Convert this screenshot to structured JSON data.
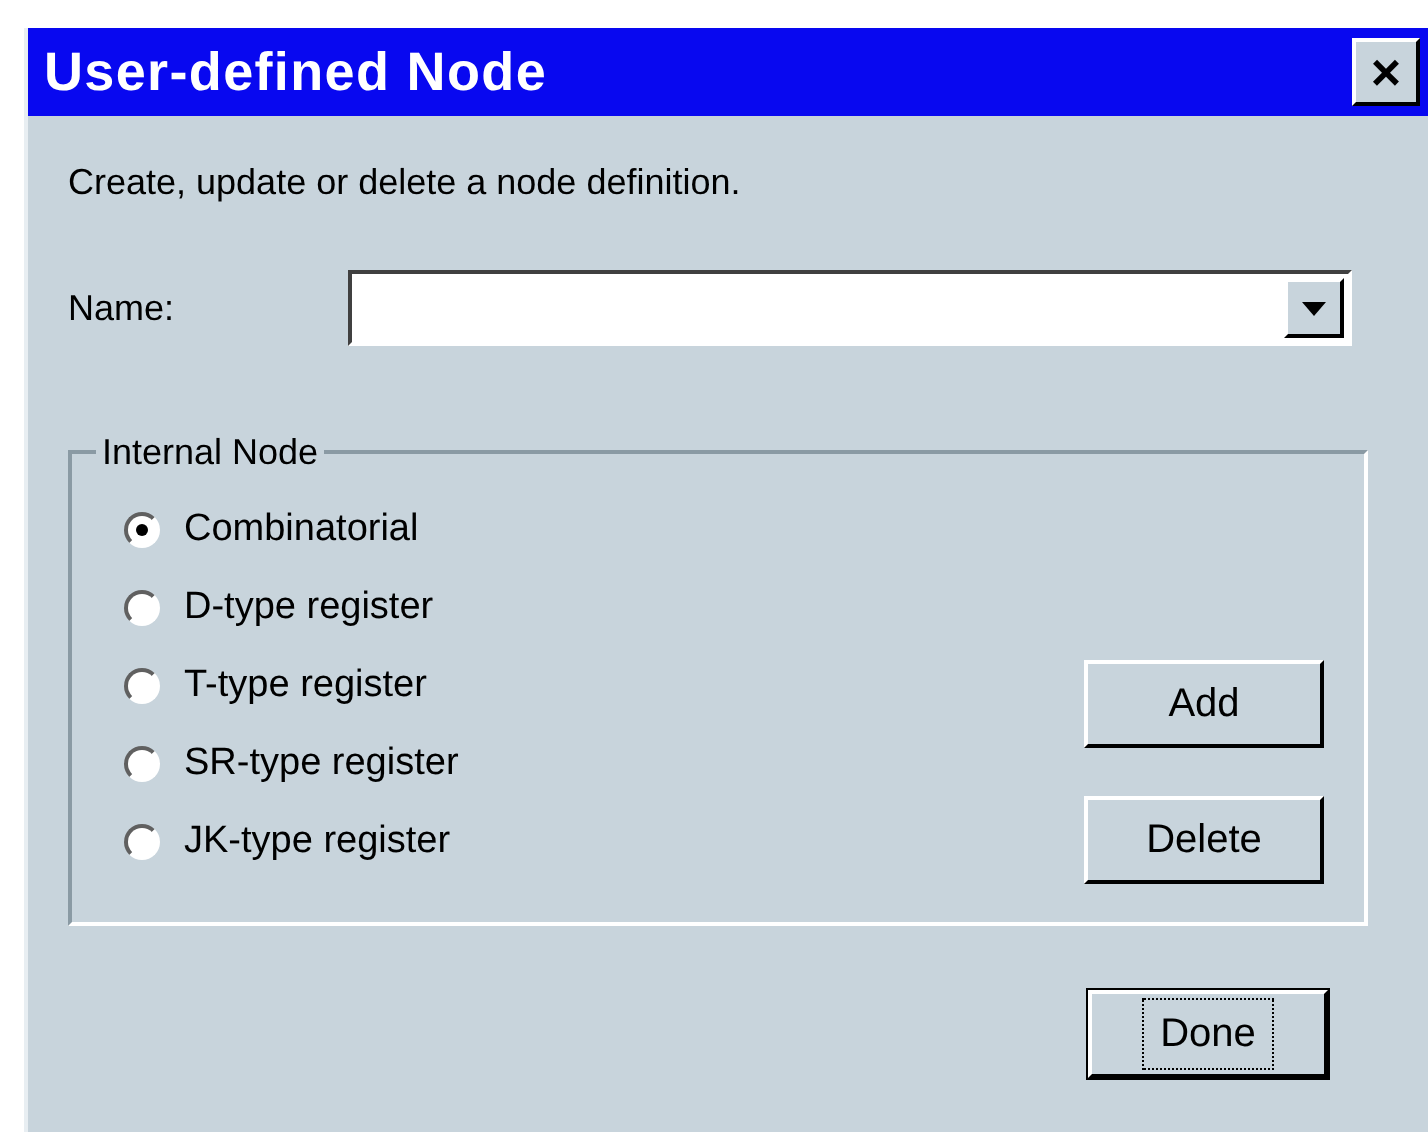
{
  "window": {
    "title": "User-defined Node",
    "close": "×"
  },
  "description": "Create, update or delete a node definition.",
  "name_field": {
    "label": "Name:"
  },
  "group": {
    "title": "Internal Node",
    "options": [
      {
        "label": "Combinatorial",
        "selected": true
      },
      {
        "label": "D-type register",
        "selected": false
      },
      {
        "label": "T-type register",
        "selected": false
      },
      {
        "label": "SR-type register",
        "selected": false
      },
      {
        "label": "JK-type register",
        "selected": false
      }
    ],
    "buttons": [
      {
        "label": "Add",
        "focused": false
      },
      {
        "label": "Delete",
        "focused": false
      }
    ]
  },
  "footer_buttons": [
    {
      "label": "Done",
      "focused": true
    }
  ]
}
